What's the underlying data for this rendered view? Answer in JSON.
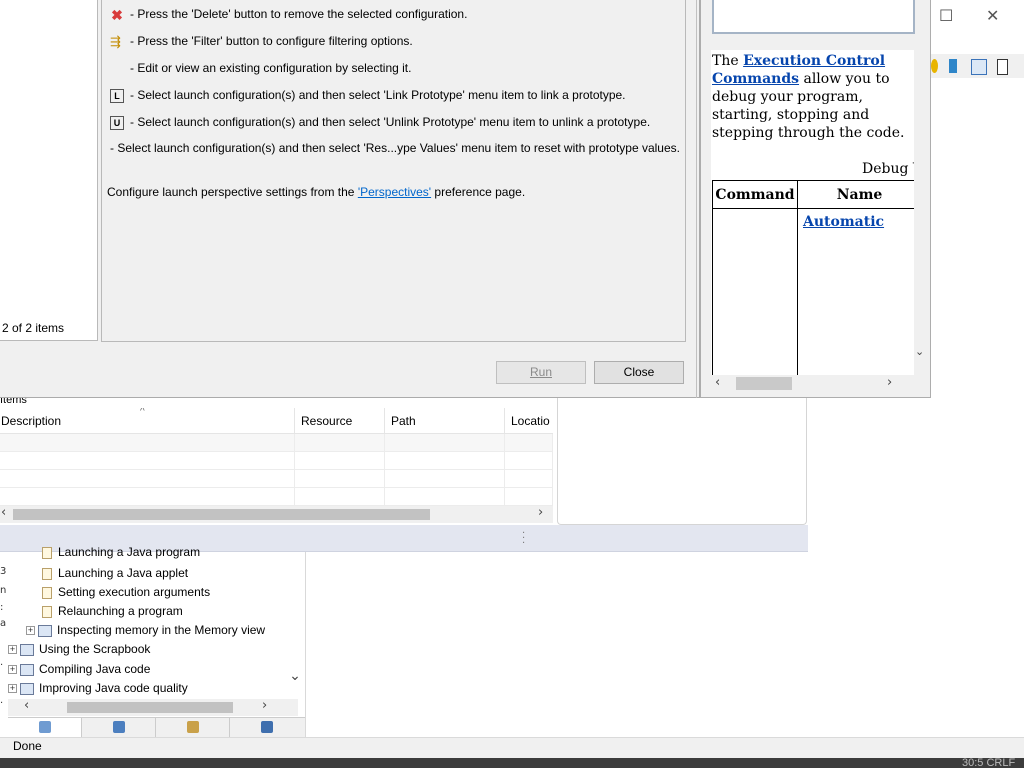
{
  "dialog": {
    "info_lines": [
      {
        "icon": "delete-icon",
        "text": "- Press the 'Delete' button to remove the selected configuration."
      },
      {
        "icon": "filter-icon",
        "text": "- Press the 'Filter' button to configure filtering options."
      },
      {
        "icon": "",
        "text": "- Edit or view an existing configuration by selecting it."
      },
      {
        "icon": "link-prototype-icon",
        "icon_text": "L",
        "text": "- Select launch configuration(s) and then select 'Link Prototype' menu item to link a prototype."
      },
      {
        "icon": "unlink-prototype-icon",
        "icon_text": "U",
        "text": "- Select launch configuration(s) and then select 'Unlink Prototype' menu item to unlink a prototype."
      },
      {
        "icon": "",
        "text": "- Select launch configuration(s) and then select 'Res...ype Values' menu item to reset with prototype values."
      }
    ],
    "perspectives_prefix": "Configure launch perspective settings from the ",
    "perspectives_link": "'Perspectives'",
    "perspectives_suffix": " preference page.",
    "items_count": "2 of 2 items",
    "run_label": "Run",
    "close_label": "Close"
  },
  "help": {
    "intro_prefix": "The ",
    "intro_link": "Execution Control Commands",
    "intro_suffix": " allow you to debug your program, starting, stopping and stepping through the code.",
    "caption": "Debug V",
    "table_headers": [
      "Command",
      "Name"
    ],
    "table_first_name_link": "Automatic"
  },
  "problems": {
    "title": "Items",
    "columns": [
      "Description",
      "Resource",
      "Path",
      "Locatio"
    ],
    "rows": 4
  },
  "tree": {
    "gutter_chars": [
      "3",
      "n",
      ":",
      "a",
      ".",
      "."
    ],
    "items": [
      {
        "level": 2,
        "icon": "page",
        "label": "Launching a Java program",
        "expander": ""
      },
      {
        "level": 2,
        "icon": "page",
        "label": "Launching a Java applet",
        "expander": ""
      },
      {
        "level": 2,
        "icon": "page",
        "label": "Setting execution arguments",
        "expander": ""
      },
      {
        "level": 2,
        "icon": "page",
        "label": "Relaunching a program",
        "expander": ""
      },
      {
        "level": 1,
        "icon": "book",
        "label": "Inspecting memory in the Memory view",
        "expander": "+"
      },
      {
        "level": 0,
        "icon": "book",
        "label": "Using the Scrapbook",
        "expander": "+"
      },
      {
        "level": 0,
        "icon": "book",
        "label": "Compiling Java code",
        "expander": "+"
      },
      {
        "level": 0,
        "icon": "book",
        "label": "Improving Java code quality",
        "expander": "+"
      }
    ],
    "tabs": [
      "contents-tab",
      "index-tab",
      "search-tab",
      "bookmarks-tab"
    ]
  },
  "status": {
    "text": "Done",
    "taskbar_text": "30:5   CRLF"
  },
  "colors": {
    "link": "#0645ad",
    "help_link": "#0066cc",
    "delete_red": "#d83b3b"
  }
}
